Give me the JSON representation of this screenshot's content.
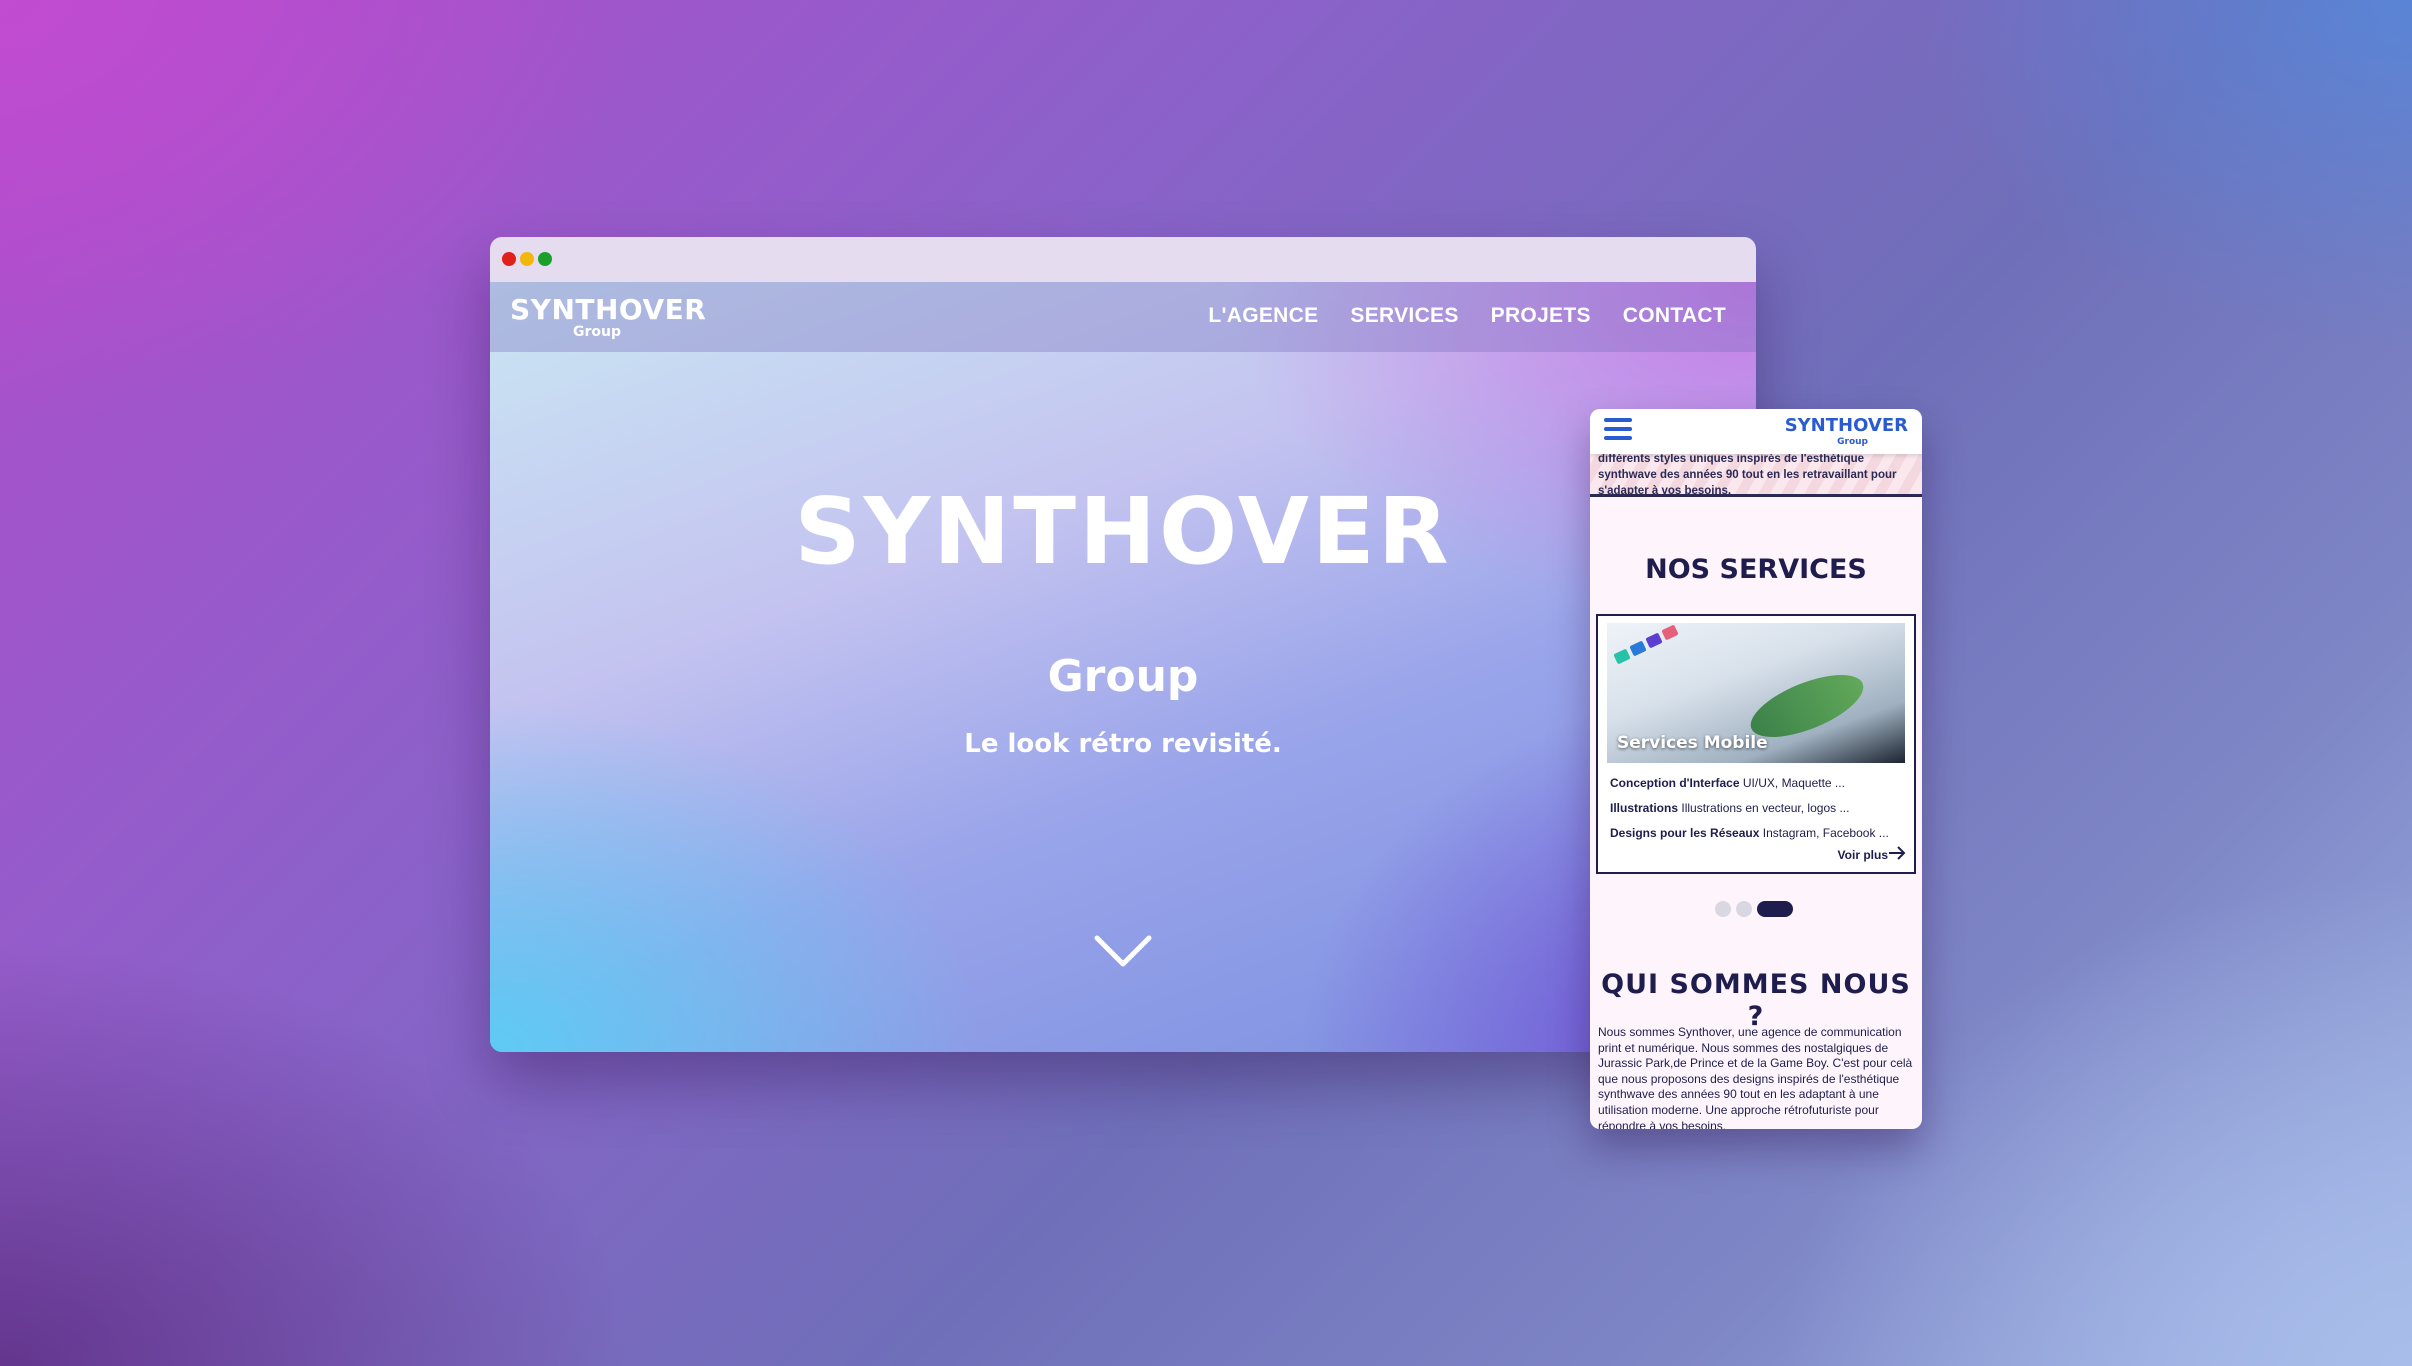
{
  "colors": {
    "traffic_red": "#e0201b",
    "traffic_yellow": "#f2b60c",
    "traffic_green": "#18a02b",
    "brand_blue": "#2a5bd0",
    "brand_navy": "#1f1d4d"
  },
  "desktop": {
    "logo": {
      "word": "SYNTHOVER",
      "group": "Group"
    },
    "nav": [
      "L'AGENCE",
      "SERVICES",
      "PROJETS",
      "CONTACT"
    ],
    "hero": {
      "word": "SYNTHOVER",
      "group": "Group",
      "tagline": "Le look rétro revisité.",
      "scroll_icon": "chevron-down-icon"
    }
  },
  "mobile": {
    "menu_icon": "hamburger-icon",
    "logo": {
      "word": "SYNTHOVER",
      "group": "Group"
    },
    "intro_text": "différents styles uniques inspirés de l'esthétique synthwave des années 90 tout en les retravaillant pour s'adapter à vos besoins.",
    "services_title": "NOS SERVICES",
    "card": {
      "image_label": "Services Mobile",
      "items": [
        {
          "title": "Conception d'Interface",
          "desc": "UI/UX, Maquette ..."
        },
        {
          "title": "Illustrations",
          "desc": "Illustrations en vecteur, logos ..."
        },
        {
          "title": "Designs pour les Réseaux",
          "desc": "Instagram, Facebook ..."
        }
      ],
      "more": "Voir plus"
    },
    "carousel": {
      "count": 3,
      "active": 3
    },
    "about_title": "QUI SOMMES NOUS ?",
    "about_text": "Nous sommes Synthover, une agence de communication print et numérique. Nous sommes des nostalgiques de Jurassic Park,de Prince et de la Game Boy. C'est pour celà que nous proposons des designs inspirés de l'esthétique synthwave des années 90 tout en les adaptant à une utilisation moderne. Une approche rétrofuturiste pour répondre à vos besoins."
  }
}
